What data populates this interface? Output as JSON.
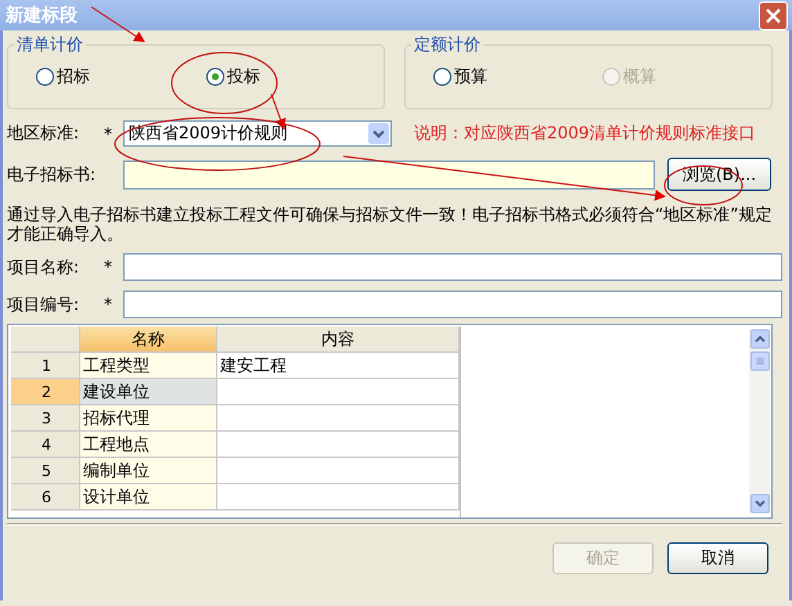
{
  "window": {
    "title": "新建标段"
  },
  "groups": [
    {
      "title": "清单计价",
      "options": [
        {
          "label": "招标",
          "selected": false,
          "disabled": false
        },
        {
          "label": "投标",
          "selected": true,
          "disabled": false
        }
      ]
    },
    {
      "title": "定额计价",
      "options": [
        {
          "label": "预算",
          "selected": false,
          "disabled": false
        },
        {
          "label": "概算",
          "selected": false,
          "disabled": true
        }
      ]
    }
  ],
  "region": {
    "label": "地区标准:",
    "required": "*",
    "value": "陕西省2009计价规则",
    "note": "说明：对应陕西省2009清单计价规则标准接口"
  },
  "ebook": {
    "label": "电子招标书:",
    "browse": "浏览(B)..."
  },
  "hint": "通过导入电子招标书建立投标工程文件可确保与招标文件一致！电子招标书格式必须符合“地区标准”规定才能正确导入。",
  "fields": [
    {
      "label": "项目名称:",
      "required": "*"
    },
    {
      "label": "项目编号:",
      "required": "*"
    }
  ],
  "table": {
    "columns": [
      {
        "label": "名称",
        "selected": true
      },
      {
        "label": "内容",
        "selected": false
      }
    ],
    "rows": [
      {
        "num": "1",
        "name": "工程类型",
        "content": "建安工程",
        "selected": false
      },
      {
        "num": "2",
        "name": "建设单位",
        "selected": true
      },
      {
        "num": "3",
        "name": "招标代理",
        "selected": false
      },
      {
        "num": "4",
        "name": "工程地点",
        "selected": false
      },
      {
        "num": "5",
        "name": "编制单位",
        "selected": false
      },
      {
        "num": "6",
        "name": "设计单位",
        "selected": false
      }
    ]
  },
  "buttons": [
    {
      "label": "确定",
      "disabled": true
    },
    {
      "label": "取消",
      "disabled": false
    }
  ]
}
